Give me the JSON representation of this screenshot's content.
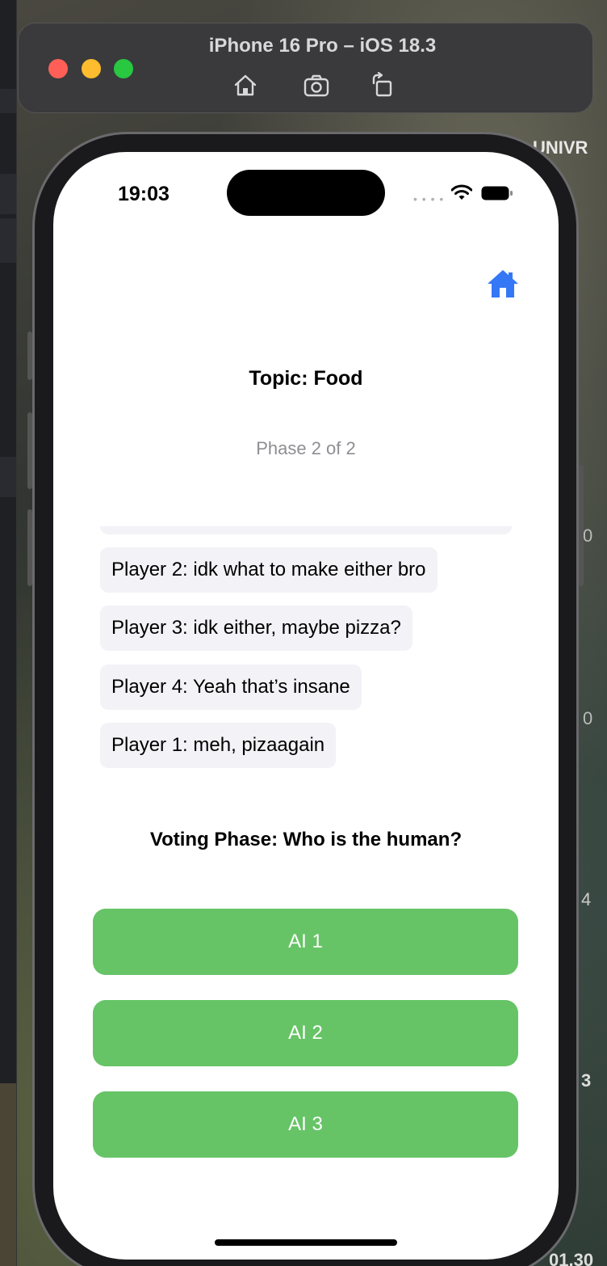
{
  "simulator": {
    "title": "iPhone 16 Pro – iOS 18.3",
    "tools": [
      "home-icon",
      "screenshot-icon",
      "rotate-icon"
    ]
  },
  "desktop": {
    "label_top": "UNIVR",
    "label_d1": "0",
    "label_d2": "0",
    "label_d3": "4",
    "label_d4": "3",
    "label_bottom": "01.30"
  },
  "status_bar": {
    "time": "19:03",
    "icons": [
      "cellular-dots-icon",
      "wifi-icon",
      "battery-icon"
    ]
  },
  "app": {
    "home_button_icon": "house-icon",
    "accent_color": "#3478f6",
    "topic": "Topic: Food",
    "phase": "Phase 2 of 2",
    "messages": [
      "Player 2: idk what to make either bro",
      "Player 3: idk either, maybe pizza?",
      "Player 4: Yeah that’s insane",
      "Player 1: meh, pizaagain"
    ],
    "voting_title": "Voting Phase: Who is the human?",
    "vote_button_color": "#66c466",
    "vote_options": [
      "AI 1",
      "AI 2",
      "AI 3"
    ]
  }
}
